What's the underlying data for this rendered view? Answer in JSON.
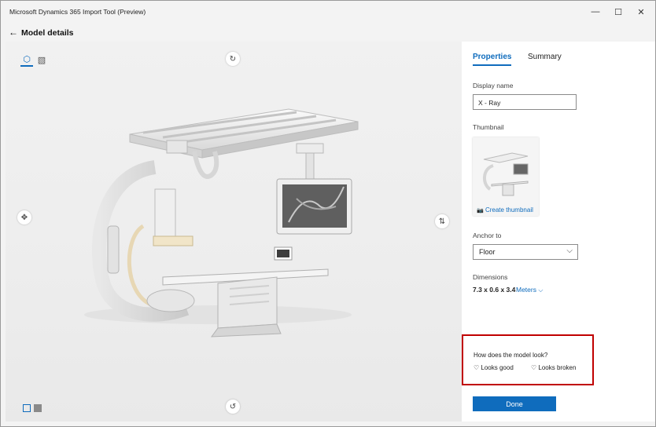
{
  "window": {
    "title": "Microsoft Dynamics 365 Import Tool (Preview)",
    "minimize_glyph": "—",
    "maximize_glyph": "☐",
    "close_glyph": "✕"
  },
  "header": {
    "back_glyph": "←",
    "title": "Model details"
  },
  "viewport": {
    "view_tabs": [
      {
        "icon": "cube-view-icon",
        "glyph": "⬡",
        "active": true
      },
      {
        "icon": "wireframe-view-icon",
        "glyph": "▧",
        "active": false
      }
    ],
    "controls": {
      "rotate_top_glyph": "↻",
      "move_left_glyph": "✥",
      "rotate_right_glyph": "⇅",
      "rotate_bottom_glyph": "↺"
    },
    "backgrounds": [
      {
        "name": "light-background-swatch",
        "color": "#f4f4f4"
      },
      {
        "name": "dark-background-swatch",
        "color": "#8a8a8a"
      }
    ]
  },
  "panel": {
    "tabs": {
      "properties": "Properties",
      "summary": "Summary"
    },
    "display_name_label": "Display name",
    "display_name_value": "X - Ray",
    "thumbnail_label": "Thumbnail",
    "create_thumbnail": "Create thumbnail",
    "camera_glyph": "📷",
    "anchor_label": "Anchor to",
    "anchor_value": "Floor",
    "chevron_glyph": "⌵",
    "dimensions_label": "Dimensions",
    "dimensions_value": "7.3 x 0.6 x 3.4",
    "units_value": "Meters",
    "feedback": {
      "question": "How does the model look?",
      "good": "Looks good",
      "broken": "Looks broken",
      "heart_glyph": "♡"
    },
    "done": "Done"
  },
  "colors": {
    "accent": "#0f6cbd",
    "highlight_border": "#c00000"
  }
}
